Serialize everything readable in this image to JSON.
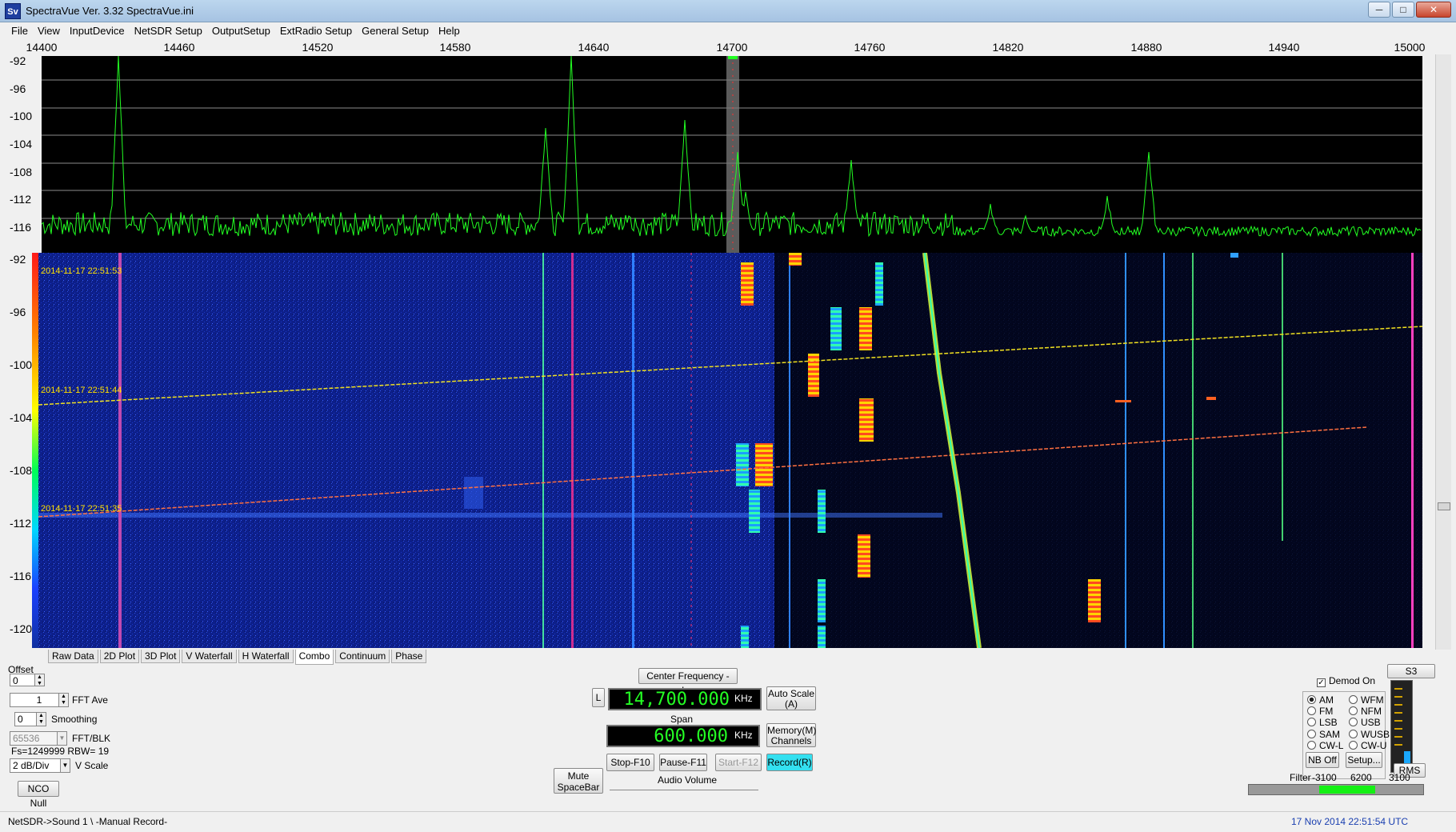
{
  "window": {
    "icon_text": "Sv",
    "title": "SpectraVue Ver. 3.32   SpectraVue.ini",
    "minimize": "─",
    "maximize": "□",
    "close": "✕"
  },
  "menu": [
    "File",
    "View",
    "InputDevice",
    "NetSDR Setup",
    "OutputSetup",
    "ExtRadio Setup",
    "General Setup",
    "Help"
  ],
  "freq_axis": [
    "14400",
    "14460",
    "14520",
    "14580",
    "14640",
    "14700",
    "14760",
    "14820",
    "14880",
    "14940",
    "15000"
  ],
  "spectrum_db": [
    "-92",
    "-96",
    "-100",
    "-104",
    "-108",
    "-112",
    "-116"
  ],
  "waterfall_db": [
    "-92",
    "-96",
    "-100",
    "-104",
    "-108",
    "-112",
    "-116",
    "-120"
  ],
  "timestamps": [
    "2014-11-17 22:51:53",
    "2014-11-17 22:51:44",
    "2014-11-17 22:51:35"
  ],
  "tabs": [
    "Raw Data",
    "2D Plot",
    "3D Plot",
    "V Waterfall",
    "H Waterfall",
    "Combo",
    "Continuum",
    "Phase"
  ],
  "active_tab": "Combo",
  "left_controls": {
    "offset_label": "Offset",
    "offset_value": "0",
    "fft_ave_value": "1",
    "fft_ave_label": "FFT Ave",
    "smoothing_value": "0",
    "smoothing_label": "Smoothing",
    "fft_blk_value": "65536",
    "fft_blk_label": "FFT/BLK",
    "fs_text": "Fs=1249999 RBW= 19",
    "vscale_value": "2 dB/Div",
    "vscale_label": "V Scale",
    "nco_null": "NCO Null"
  },
  "center": {
    "center_freq_button": "Center Frequency - Ins",
    "l_button": "L",
    "center_freq_value": "14,700.000",
    "freq_unit": "KHz",
    "auto_scale_line1": "Auto Scale",
    "auto_scale_line2": "(A)",
    "span_label": "Span",
    "span_value": "600.000",
    "span_unit": "KHz",
    "memory_line1": "Memory(M)",
    "memory_line2": "Channels",
    "mute_line1": "Mute",
    "mute_line2": "SpaceBar",
    "stop": "Stop-F10",
    "pause": "Pause-F11",
    "start": "Start-F12",
    "record": "Record(R)",
    "audio_volume": "Audio Volume"
  },
  "demod": {
    "demod_on": "Demod On",
    "modes_left": [
      "AM",
      "FM",
      "LSB",
      "SAM",
      "CW-L"
    ],
    "modes_right": [
      "WFM",
      "NFM",
      "USB",
      "WUSB",
      "CW-U"
    ],
    "selected": "AM",
    "nb_off": "NB Off",
    "setup": "Setup...",
    "s_meter": "S3",
    "rms": "RMS",
    "filter_label": "Filter",
    "filter_low": "-3100",
    "filter_width": "6200",
    "filter_high": "3100"
  },
  "status": {
    "left": "NetSDR->Sound 1  \\ -Manual Record-",
    "right": "17 Nov 2014  22:51:54 UTC"
  },
  "colors": {
    "spectrum_trace": "#22ff22",
    "lcd_text": "#24ff24",
    "record_button": "#34e0f0",
    "status_date": "#1a3fb0"
  }
}
